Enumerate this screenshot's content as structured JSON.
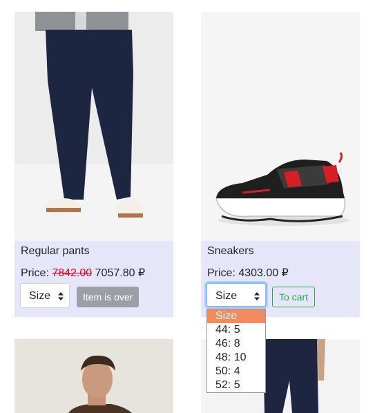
{
  "products": [
    {
      "name": "Regular pants",
      "price_label": "Price:",
      "old_price": "7842.00",
      "price": "7057.80 ₽",
      "size_placeholder": "Size",
      "button": "Item is over"
    },
    {
      "name": "Sneakers",
      "price_label": "Price:",
      "price": "4303.00 ₽",
      "size_placeholder": "Size",
      "button": "To cart"
    }
  ],
  "size_dropdown": {
    "options": [
      "Size",
      "44: 5",
      "46: 8",
      "48: 10",
      "50: 4",
      "52: 5"
    ],
    "highlighted": "Size"
  },
  "colors": {
    "info_bg": "#e6e6fa",
    "old_price": "#e3001b",
    "cart_green": "#28a745",
    "highlight": "#f28c5e",
    "disabled_button": "#9aa0a6"
  }
}
